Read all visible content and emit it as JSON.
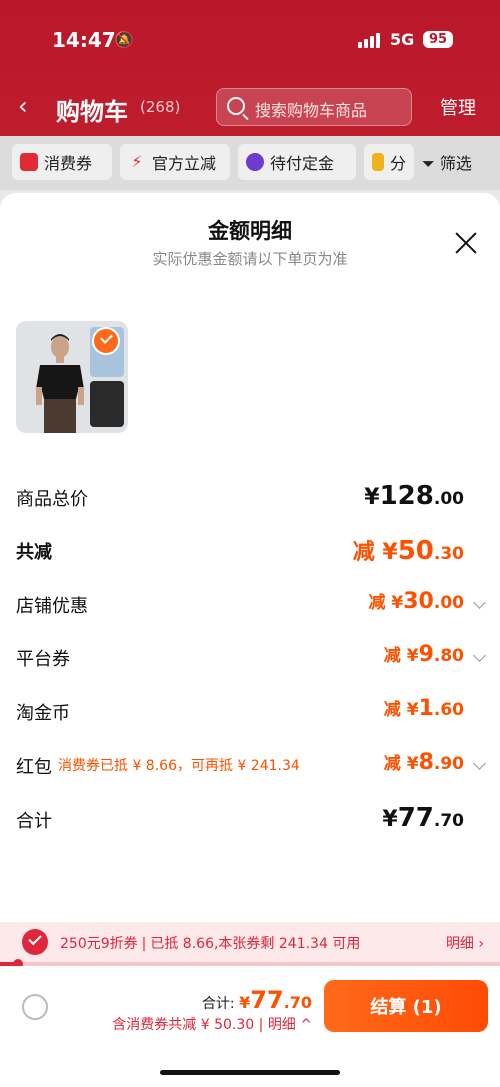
{
  "status_bar": {
    "time": "14:47",
    "network": "5G",
    "battery": "95"
  },
  "header": {
    "back": "‹",
    "title": "购物车",
    "count": "(268)",
    "search_placeholder": "搜索购物车商品",
    "manage": "管理"
  },
  "filters": [
    {
      "label": "消费券"
    },
    {
      "label": "官方立减"
    },
    {
      "label": "待付定金"
    },
    {
      "label": "分"
    }
  ],
  "filter_button": "筛选",
  "sheet": {
    "title": "金额明细",
    "subtitle": "实际优惠金额请以下单页为准"
  },
  "rows": {
    "total_price": {
      "label": "商品总价",
      "currency": "¥",
      "int": "128",
      "dec": ".00"
    },
    "discount": {
      "label": "共减",
      "prefix": "减 ",
      "currency": "¥",
      "int": "50",
      "dec": ".30"
    },
    "shop": {
      "label": "店铺优惠",
      "prefix": "减 ",
      "currency": "¥",
      "int": "30",
      "dec": ".00"
    },
    "platform": {
      "label": "平台券",
      "prefix": "减 ",
      "currency": "¥",
      "int": "9",
      "dec": ".80"
    },
    "coin": {
      "label": "淘金币",
      "prefix": "减 ",
      "currency": "¥",
      "int": "1",
      "dec": ".60"
    },
    "redpacket": {
      "label": "红包",
      "note": "消费券已抵 ¥ 8.66，可再抵 ¥ 241.34",
      "prefix": "减 ",
      "currency": "¥",
      "int": "8",
      "dec": ".90"
    },
    "sum": {
      "label": "合计",
      "currency": "¥",
      "int": "77",
      "dec": ".70"
    }
  },
  "coupon_bar": {
    "name": "250元9折券",
    "info": "已抵 8.66,本张券剩 241.34 可用",
    "detail": "明细 ›",
    "progress_fraction": 0.035
  },
  "bottom": {
    "total_label": "合计: ",
    "total_currency": "¥",
    "total_int": "77",
    "total_dec": ".70",
    "saved": "含消费券共减 ¥ 50.30",
    "detail": "明细 ^",
    "checkout": "结算 (1)"
  },
  "colors": {
    "brand_red": "#c01f2f",
    "accent_orange": "#ff5000",
    "coupon_red": "#e0263a"
  }
}
